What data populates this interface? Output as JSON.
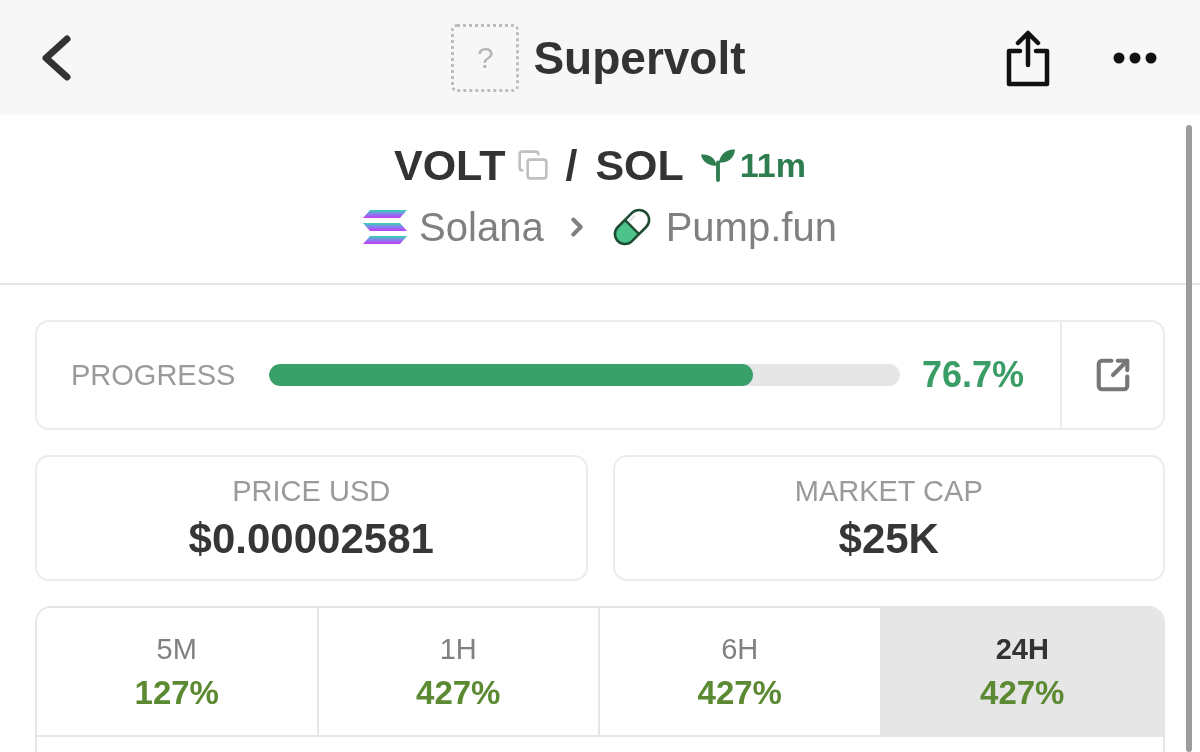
{
  "header": {
    "logo_placeholder": "?",
    "title": "Supervolt"
  },
  "pair": {
    "base": "VOLT",
    "separator": "/",
    "quote": "SOL",
    "age": "11m",
    "chain": "Solana",
    "dex": "Pump.fun"
  },
  "progress": {
    "label": "PROGRESS",
    "level": 0.767,
    "reading": "76.7%"
  },
  "stats": [
    {
      "label": "PRICE USD",
      "value": "$0.00002581"
    },
    {
      "label": "MARKET CAP",
      "value": "$25K"
    }
  ],
  "timeframes": [
    {
      "label": "5M",
      "change": "127%",
      "selected": false
    },
    {
      "label": "1H",
      "change": "427%",
      "selected": false
    },
    {
      "label": "6H",
      "change": "427%",
      "selected": false
    },
    {
      "label": "24H",
      "change": "427%",
      "selected": true
    }
  ]
}
